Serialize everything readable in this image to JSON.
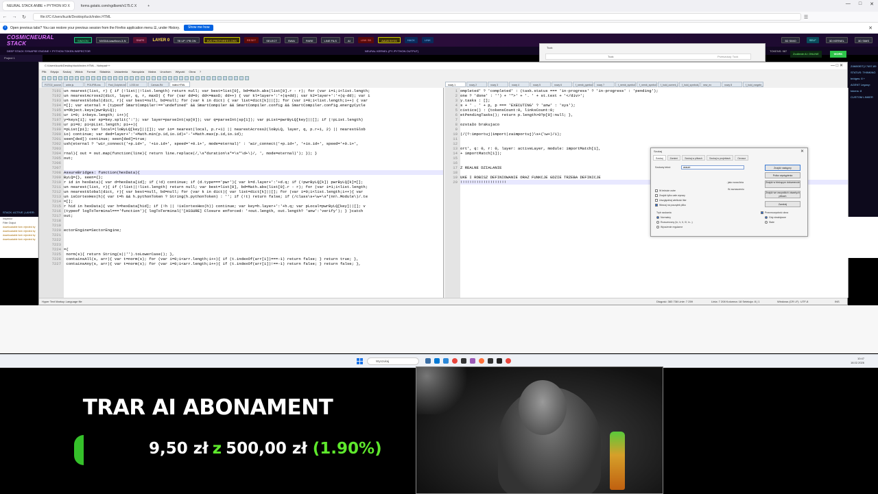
{
  "browser": {
    "tabs": [
      {
        "label": "NEURAL STACK ANBE + PYTHON I/O X"
      },
      {
        "label": "forms.gstatic.com/ngdbsmi/v175.C X"
      }
    ],
    "new_tab": "+",
    "url": "file:///C:/Users/kuzik/Desktop/tuck/index.HTML",
    "restore_text": "Open previous tabs? You can restore your previous session from the Firefox application menu ☰, under History.",
    "restore_button": "Show me how"
  },
  "app": {
    "logo": "COSMICNEURAL STACK",
    "subtitle": "DEEP STACK SYNAPSE ENGINE + PYTHON TOKEN INSPECTOR",
    "project": "Project 1",
    "layer_label": "LAYER 0",
    "buttons": [
      "SIMXON",
      "NVIDIA-kawthron-3-N",
      "SNIPE",
      "7B UP / PB ON",
      "SVD PROTHRES LOSS",
      "RESET",
      "SELECT",
      "SWAI",
      "PARE",
      "LINE FILS",
      "AI",
      "LINK SB",
      "AAUB BYSS",
      "HACK",
      "LINK"
    ],
    "right_buttons": [
      "3D SIMO",
      "SELF",
      "3D KERNEL",
      "3D SIMS"
    ],
    "neural_kernel": "NEURAL KERNEL (PY /PYTHON OUTPUT)",
    "status": "Zcollenie AI: ONLINE",
    "work": "WORK",
    "tokens": "TOKENS: 987",
    "left_label": "STACK: ACTIVE | LAYER:",
    "right_status": [
      "Z4M00EIT|J 7497-89",
      "STATUS: THINKING",
      "bridges: 8 +",
      "AGENT Legacy:",
      "tokens: 8",
      "CUSTOM LINKER"
    ]
  },
  "notepad": {
    "title": "C:\\Users\\kuzik\\Desktop\\tuck\\index.HTML - Notepad++",
    "menu": [
      "Plik",
      "Edycja",
      "Szukaj",
      "Widok",
      "Format",
      "Składnia",
      "Ustawienia",
      "Narzędzia",
      "Makra",
      "Uruchom",
      "Wtyczki",
      "Okna",
      "?"
    ],
    "left_tabs": [
      "FOTO2_source.txt",
      "anbe.js",
      "POLIFIB.css",
      "Fwd_Dolphin.txt",
      "LOGI.txt",
      "Canvas.Rd",
      "index.HTML"
    ],
    "right_tabs": [
      "nowy 1",
      "nowy 2",
      "nowy 3",
      "nowy 4",
      "nowy 5",
      "nowy 6",
      "f_nemb_pymbols_list.css",
      "nowy 7",
      "f_nemb_symbols_2.css",
      "f_nemb_symbols_3.css",
      "f_hold_current_rl.css",
      "f_hold_symbols_rl.css",
      "new_ex",
      "nowy 8",
      "f_hold_rangele_list.css"
    ],
    "left_lines": [
      {
        "n": "7191",
        "t": "un nearest(list, r) { if (!list||!list.length) return null; var best=list[0], bd=Math.abs(list[0].r - r); for (var i=1;i<list.length;"
      },
      {
        "n": "7192",
        "t": "un nearestAcross2(dict, layer, q, r, maxD) { for (var dd=0; dd<=maxD; dd++) { var kl=layer+':'+(q+dd); var k2=layer+':'+(q-dd); var i"
      },
      {
        "n": "7193",
        "t": "un nearestGlobal(dict, r){ var best=null, bd=null; for (var k in dict) { var list=dict[k]||[]; for (var i=0;i<list.length;i++) { var"
      },
      {
        "n": "7194",
        "t": "=[]; var eternal = (typeof SmartCompiler!=='undefined' && SmartCompiler && SmartCompiler.config && SmartCompiler.config.energyCycle"
      },
      {
        "n": "7195",
        "t": "s=Object.keys(pwrByLQ);"
      },
      {
        "n": "7196",
        "t": "ur i=0; i<keys.length; i++){"
      },
      {
        "n": "7197",
        "t": "y=keys[i]; var sp=key.split(':'); var layer=parseInt(sp[0]); var q=parseInt(sp[1]); var pList=pwrByLQ[key]||[]; if (!pList.length)"
      },
      {
        "n": "7198",
        "t": "ur pi=0; pi<pList.length; pi++){"
      },
      {
        "n": "7199",
        "t": "=pList[pi]; var local=(loByLQ[key]||[]); var io= nearest(local, p.r+1) || nearestAcross2(loByLQ, layer, q, p.r+1, 2) || nearestGlob"
      },
      {
        "n": "7200",
        "t": "io) continue; var ded=layer+':'+Math.min(p.id,io.id)+'-'+Math.max(p.id,io.id);"
      },
      {
        "n": "7201",
        "t": "seen[ded]) continue; seen[ded]=true;"
      },
      {
        "n": "7202",
        "t": "ush(eternal ? 'wir_connect('+p.id+', '+io.id+', speed='+0.1+', mode=eternal)' : 'wir_connect('+p.id+', '+io.id+', speed='+0.1+',"
      },
      {
        "n": "7203",
        "t": ""
      },
      {
        "n": "7204",
        "t": "rnal){ out = out.map(function(line){ return line.replace(/,\\s*duration\\s*=\\s*\\d+\\)/, ', mode=eternal)'); }); }"
      },
      {
        "n": "7205",
        "t": "out;"
      },
      {
        "n": "7206",
        "t": ""
      },
      {
        "n": "7207",
        "t": ""
      },
      {
        "n": "7208",
        "t": "AssureBridges: function(hexData){",
        "hl": true
      },
      {
        "n": "7209",
        "t": "ByLQ={}, seen={};"
      },
      {
        "n": "7210",
        "t": "r id in hexData){ var d=hexData[id]; if (!d) continue; if (d.type==='pwr'){ var k=d.layer+':'+d.q; if (!pwrByLQ[k]) pwrByLQ[k]=[];"
      },
      {
        "n": "7211",
        "t": "un nearest(list, r){ if (!list||!list.length) return null; var best=list[0], bd=Math.abs(list[0].r - r); for (var i=1;i<list.length;"
      },
      {
        "n": "7212",
        "t": "un nearestGlobal(dict, r){ var best=null, bd=null; for (var k in dict){ var list=dict[k]||[]; for (var i=0;i<list.length;i++){ var"
      },
      {
        "n": "7213",
        "t": "un isCortexHex(h){ var t=h && h.pythonToken ? String(h.pythonToken) : ''; if (!t) return false; if (/class\\s+\\w+\\s*(nn\\.Module\\)/.te"
      },
      {
        "n": "7214",
        "t": "=[];"
      },
      {
        "n": "7215",
        "t": "r hid in hexData){ var h=hexData[hid]; if (!h || !isCortexHex(h)) continue; var key=h.layer+':'+h.q; var pLocal=pwrByLQ[key]||[]; v"
      },
      {
        "n": "7216",
        "t": "(typeof logToTerminal==='function'){ logToTerminal('[ASSURE] Closure enforced: '+out.length, out.length? 'anw':'verify'); } }catch"
      },
      {
        "n": "7217",
        "t": "out;"
      },
      {
        "n": "7218",
        "t": ""
      },
      {
        "n": "7219",
        "t": ""
      },
      {
        "n": "7220",
        "t": "ectorEngine=SectorEngine;"
      },
      {
        "n": "7221",
        "t": ""
      },
      {
        "n": "7222",
        "t": ""
      },
      {
        "n": "7223",
        "t": ""
      },
      {
        "n": "7224",
        "t": "={"
      },
      {
        "n": "7225",
        "t": " norm(s){ return String(s||'').toLowerCase(); },"
      },
      {
        "n": "7226",
        "t": " containsAll(s, arr){ var t=norm(s); for (var i=0;i<arr.length;i++){ if (t.indexOf(arr[i])===-1) return false; } return true; },"
      },
      {
        "n": "7227",
        "t": " containsAny(s, arr){ var t=norm(s); for (var i=0;i<arr.length;i++){ if (t.indexOf(arr[i])!==-1) return false; } return false; },"
      }
    ],
    "right_lines": [
      {
        "n": "1",
        "t": "ompleted' ? 'completed' : (task.status === 'in-progress' ? 'in-progress' : 'pending');"
      },
      {
        "n": "2",
        "t": "one ? 'done' : '') + '\">' + '. ' + st.text + '</div>';"
      },
      {
        "n": "3",
        "t": "y.tasks : [];"
      },
      {
        "n": "4",
        "t": "s + ' . ' + p, p === 'EXECUTING' ? 'anw' : 'sys');"
      },
      {
        "n": "5",
        "t": "cistics() : {tokensCount:0, linksCount:0;"
      },
      {
        "n": "6",
        "t": "etPendingTasks(); return p.length>0?p[0]:null; },"
      },
      {
        "n": "7",
        "t": ""
      },
      {
        "n": "8",
        "t": "ozstało brakujaco"
      },
      {
        "n": "9",
        "t": ""
      },
      {
        "n": "10",
        "t": "(/(?:importuj|import|zaimportuj)\\s+(\\w+)/i);"
      },
      {
        "n": "11",
        "t": ""
      },
      {
        "n": "12",
        "t": ""
      },
      {
        "n": "13",
        "t": "ort', q: 0, r: 0, layer: activeLayer, module: importMatch[1],"
      },
      {
        "n": "14",
        "t": "+ importMatch[1]);"
      },
      {
        "n": "15",
        "t": ""
      },
      {
        "n": "16",
        "t": ""
      },
      {
        "n": "17",
        "t": "Z REALNE DZIALANIE"
      },
      {
        "n": "18",
        "t": ""
      },
      {
        "n": "19",
        "t": "UKE I ROBISZ DEFINIOWANIE ORAZ FUNKCJE GDZIE TRZEBA DEFINICJE"
      },
      {
        "n": "20",
        "t": "!!!!!!!!!!!!!!!!!!!!",
        "hl": true
      }
    ],
    "status_left": "Hyper Text Markup Language file",
    "status_length": "Długość: 383 738   Linie: 7 259",
    "status_pos": "Linia: 7 208   Kolumna: 18   Selekcja: 8 | 1",
    "status_eol": "Windows (CR LF)",
    "status_enc": "UTF-8",
    "status_ins": "INS"
  },
  "find_dialog": {
    "title": "Szukaj",
    "tabs": [
      "Szukaj",
      "Zamień",
      "Szukaj w plikach",
      "Szukaj w projektach",
      "Oznacz"
    ],
    "label": "Szukany tekst:",
    "value": "assure",
    "buttons": [
      "Znajdź następny",
      "Policz wystąpienia",
      "Znajdź w bieżącym dokumencie",
      "Znajdź we wszystkich otwartych plikach",
      "Zamknij"
    ],
    "checks": [
      "W tekście ostre",
      "Znajdź tylko całe wyrazy",
      "Uwzględniaj wielkość liter",
      "Wracaj na początek pliku"
    ],
    "mode_label": "Tryb szukania",
    "modes": [
      "Normalny",
      "Rozszerzony (\\n, \\r, \\t, \\0, \\x...)",
      "Wyrażenie regularne"
    ],
    "dot_label": ". jako nowa linia",
    "transparency_label": "Przezroczystość okna",
    "transparency_opts": [
      "Gdy nieaktywne",
      "Stale"
    ],
    "in_selection": "W zaznaczeniu"
  },
  "mini_browser": {
    "tab": "Tuck",
    "address": "Tuck",
    "search": "Przeszukaj: Tuck"
  },
  "devtools": {
    "header": "Inspector",
    "filter": "Filter Output",
    "rows": [
      "downloadable font: rejected by",
      "downloadable font: rejected by",
      "downloadable font: rejected by",
      "downloadable font: rejected by"
    ]
  },
  "taskbar": {
    "search": "Wyszukaj",
    "time": "10:47",
    "date": "18.02.2026"
  },
  "overlay": {
    "title": "TRAR AI ABONAMENT",
    "current": "9,50 zł",
    "connector": "z",
    "goal": "500,00 zł",
    "percent": "(1.90%)",
    "progress": 0.019
  }
}
